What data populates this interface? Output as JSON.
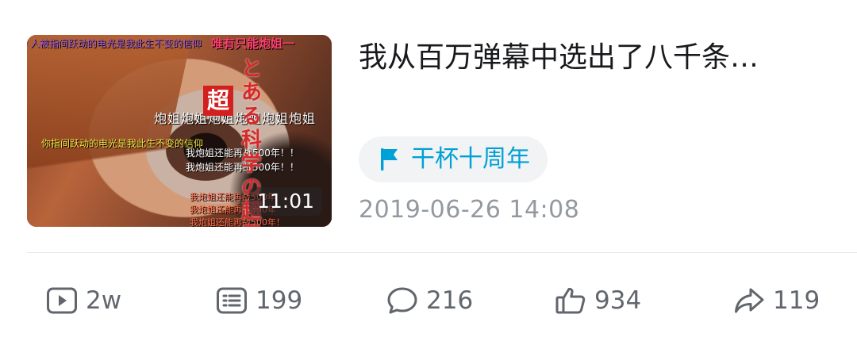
{
  "video": {
    "title": "我从百万弹幕中选出了八千条…",
    "duration": "11:01",
    "tag": {
      "label": "干杯十周年",
      "icon": "flag-icon",
      "color": "#00a1d6"
    },
    "date": "2019-06-26 14:08"
  },
  "thumbnail": {
    "danmaku": [
      "人被指间跃动的电光是我此生不变的信仰",
      "唯有只能炮姐一",
      "炮姐炮姐炮姐炮姐炮姐炮姐",
      "你指间跃动的电光是我此生不变的信仰",
      "我炮姐还能再战500年！！",
      "我炮姐还能再战500年！！",
      "我炮姐还能再战500年",
      "我炮姐还能再战500年",
      "我炮姐还能再战500年！"
    ],
    "vertical_title": "とある科学の超電磁砲",
    "badge_char": "超"
  },
  "stats": {
    "views": {
      "icon": "play-icon",
      "value": "2w"
    },
    "danmaku": {
      "icon": "danmaku-icon",
      "value": "199"
    },
    "comments": {
      "icon": "comment-icon",
      "value": "216"
    },
    "likes": {
      "icon": "thumbs-up-icon",
      "value": "934"
    },
    "shares": {
      "icon": "share-icon",
      "value": "119"
    }
  },
  "colors": {
    "title": "#18191c",
    "secondary": "#9499a0",
    "stat": "#61666d",
    "accent": "#00a1d6",
    "tag_bg": "#f1f3f5"
  }
}
